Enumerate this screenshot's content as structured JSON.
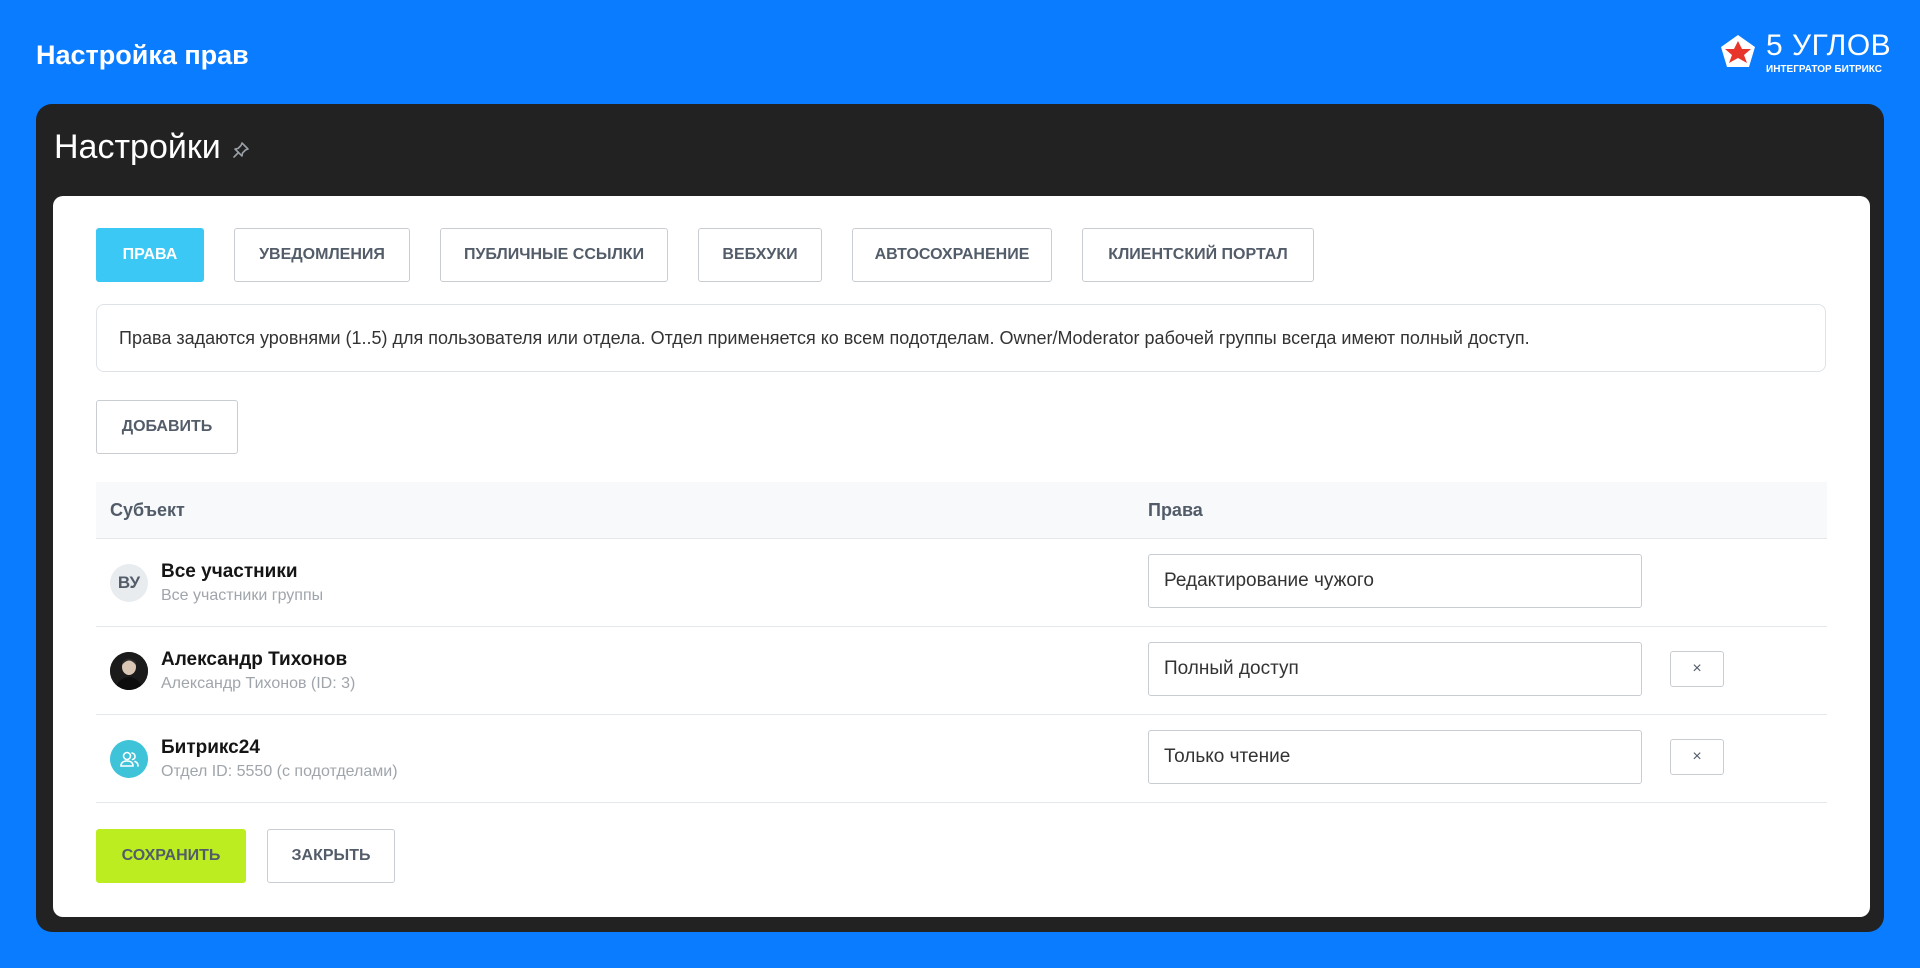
{
  "page": {
    "title": "Настройка прав"
  },
  "brand": {
    "name": "5 УГЛОВ",
    "subtitle": "ИНТЕГРАТОР БИТРИКС"
  },
  "app": {
    "title": "Настройки"
  },
  "tabs": [
    {
      "label": "ПРАВА",
      "active": true
    },
    {
      "label": "УВЕДОМЛЕНИЯ",
      "active": false
    },
    {
      "label": "ПУБЛИЧНЫЕ ССЫЛКИ",
      "active": false
    },
    {
      "label": "ВЕБХУКИ",
      "active": false
    },
    {
      "label": "АВТОСОХРАНЕНИЕ",
      "active": false
    },
    {
      "label": "КЛИЕНТСКИЙ ПОРТАЛ",
      "active": false
    }
  ],
  "info": {
    "text": "Права задаются уровнями (1..5) для пользователя или отдела. Отдел применяется ко всем подотделам. Owner/Moderator рабочей группы всегда имеют полный доступ."
  },
  "actions": {
    "add_label": "ДОБАВИТЬ",
    "save_label": "СОХРАНИТЬ",
    "close_label": "ЗАКРЫТЬ"
  },
  "table": {
    "columns": {
      "subject": "Субъект",
      "rights": "Права"
    },
    "rows": [
      {
        "initials": "ВУ",
        "name": "Все участники",
        "sub": "Все участники группы",
        "rights": "Редактирование чужого",
        "removable": false
      },
      {
        "initials": "",
        "name": "Александр Тихонов",
        "sub": "Александр Тихонов (ID: 3)",
        "rights": "Полный доступ",
        "removable": true
      },
      {
        "initials": "",
        "name": "Битрикс24",
        "sub": "Отдел ID: 5550 (с подотделами)",
        "rights": "Только чтение",
        "removable": true
      }
    ],
    "remove_label": "×"
  },
  "colors": {
    "background": "#0a7cff",
    "window": "#222222",
    "tab_active": "#3bc8f5",
    "save_button": "#bbed21",
    "dept_avatar": "#3ec3d9"
  },
  "icons": {
    "brand": "pentagon-star-logo-icon",
    "pin": "pin-icon",
    "dept_avatar": "user-group-icon",
    "user_avatar": "user-photo-icon"
  }
}
